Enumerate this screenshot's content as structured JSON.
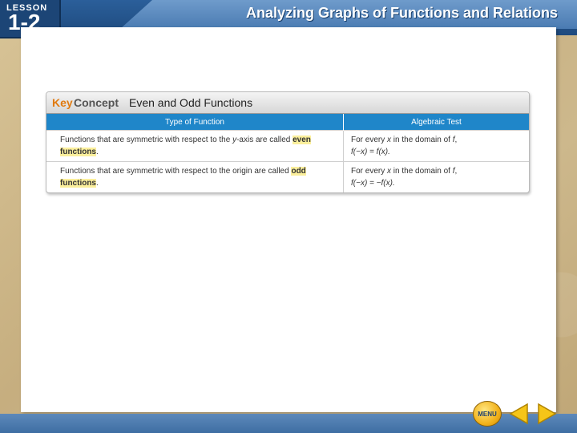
{
  "header": {
    "lesson_word": "LESSON",
    "lesson_number": "1-2",
    "title": "Analyzing Graphs of Functions and Relations"
  },
  "key_concept": {
    "key": "Key",
    "concept": "Concept",
    "title": "Even and Odd Functions",
    "columns": [
      "Type of Function",
      "Algebraic Test"
    ],
    "rows": [
      {
        "type_pre": "Functions that are symmetric with respect to the ",
        "type_var": "y",
        "type_mid": "-axis are called ",
        "type_term": "even functions",
        "type_end": ".",
        "test_pre": "For every ",
        "test_var": "x",
        "test_mid": " in the domain of ",
        "test_fn": "f",
        "test_end": ",",
        "test_eq": "f(−x) = f(x)."
      },
      {
        "type_pre": "Functions that are symmetric with respect to the origin are called ",
        "type_term": "odd functions",
        "type_end": ".",
        "test_pre": "For every ",
        "test_var": "x",
        "test_mid": " in the domain of ",
        "test_fn": "f",
        "test_end": ",",
        "test_eq": "f(−x) = −f(x)."
      }
    ]
  },
  "nav": {
    "menu_label": "MENU",
    "prev_icon": "triangle-left-icon",
    "next_icon": "triangle-right-icon"
  },
  "colors": {
    "header_blue": "#1e4a7e",
    "table_header_blue": "#1f86c9",
    "key_orange": "#e07a10",
    "highlight_yellow": "#fbef9c",
    "arrow_yellow": "#f5c518"
  }
}
